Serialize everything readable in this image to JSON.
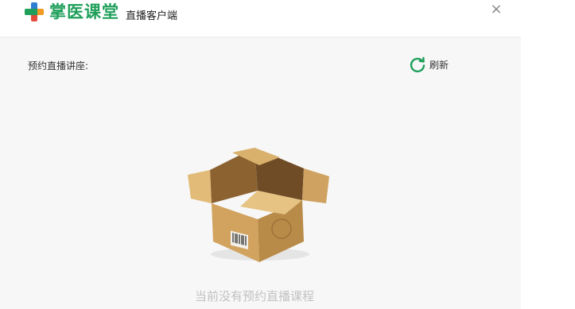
{
  "app": {
    "brand_name": "掌医课堂",
    "subtitle": "直播客户端",
    "close_label": "×"
  },
  "content": {
    "section_label": "预约直播讲座:",
    "refresh_label": "刷新",
    "empty_message": "当前没有预约直播课程"
  },
  "colors": {
    "brand_green": "#1f9f5a",
    "cross_blue": "#2e7fd0",
    "cross_orange": "#f19a24",
    "cross_red": "#e44b3a"
  },
  "icons": {
    "logo": "medical-cross-icon",
    "refresh": "refresh-icon",
    "close": "close-icon",
    "empty": "open-box-icon"
  }
}
